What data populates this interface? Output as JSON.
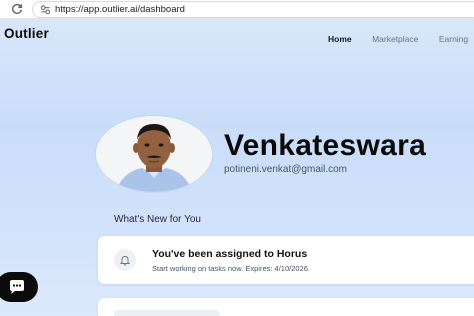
{
  "browser": {
    "url": "https://app.outlier.ai/dashboard",
    "reload_icon": "reload-icon",
    "site_info_icon": "lock-icon"
  },
  "header": {
    "logo": "Outlier",
    "nav": [
      {
        "label": "Home",
        "active": true
      },
      {
        "label": "Marketplace",
        "active": false
      },
      {
        "label": "Earning",
        "active": false
      }
    ]
  },
  "profile": {
    "name": "Venkateswara",
    "email": "potineni.venkat@gmail.com",
    "avatar_icon": "user-avatar"
  },
  "whats_new": {
    "title": "What's New for You",
    "notification": {
      "icon": "bell-icon",
      "title": "You've been assigned to Horus",
      "body": "Start working on tasks now. Expires: 4/10/2026."
    }
  },
  "chat": {
    "icon": "chat-icon"
  },
  "colors": {
    "background_top": "#dbe8fb",
    "background_mid": "#c9ddf9",
    "chat_fab": "#0b0b0b",
    "card": "#ffffff"
  }
}
